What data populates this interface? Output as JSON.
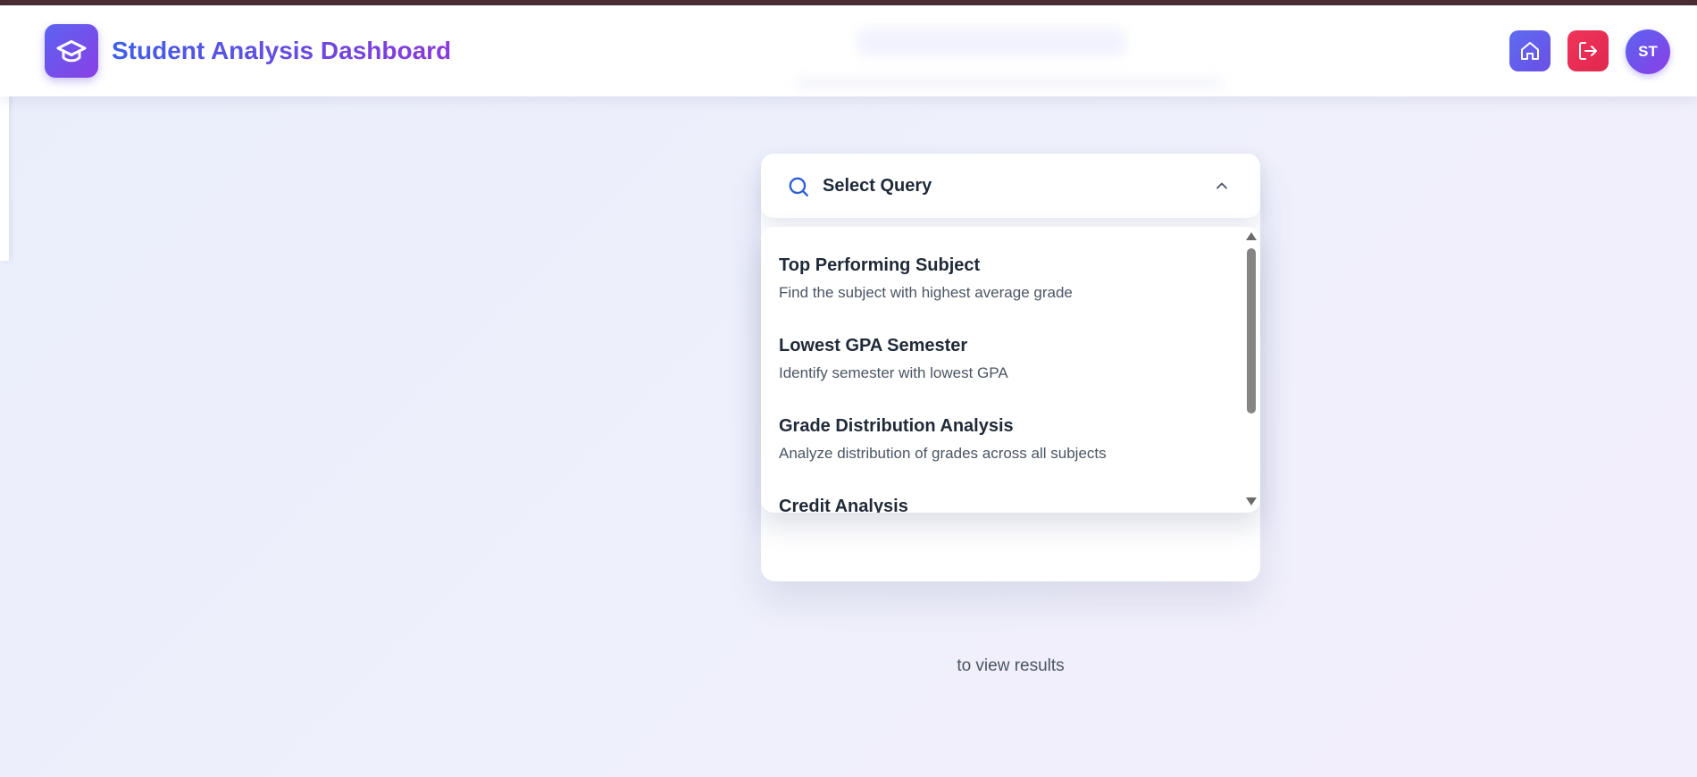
{
  "app": {
    "title": "Student Analysis Dashboard",
    "brand_icon": "graduation-cap-icon"
  },
  "header_actions": {
    "home_icon": "home-icon",
    "logout_icon": "logout-icon",
    "avatar_initials": "ST"
  },
  "query_select": {
    "label": "Select Query",
    "icon": "search-icon",
    "toggle_icon": "chevron-up-icon",
    "options": [
      {
        "title": "Top Performing Subject",
        "description": "Find the subject with highest average grade"
      },
      {
        "title": "Lowest GPA Semester",
        "description": "Identify semester with lowest GPA"
      },
      {
        "title": "Grade Distribution Analysis",
        "description": "Analyze distribution of grades across all subjects"
      },
      {
        "title": "Credit Analysis",
        "description": ""
      }
    ]
  },
  "result_card": {
    "text_line2": "to view results"
  },
  "colors": {
    "accent_start": "#5b63f0",
    "accent_end": "#8a3fe6",
    "logout": "#f0355a",
    "top_strip": "#4a2c33"
  }
}
